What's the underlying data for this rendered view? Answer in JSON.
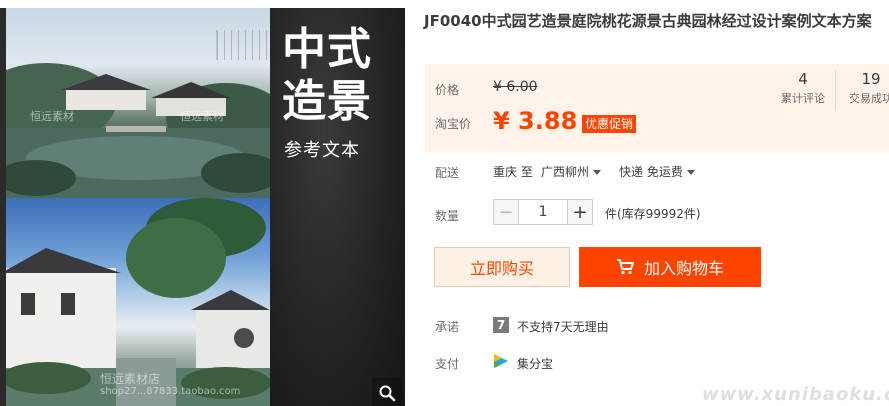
{
  "gallery": {
    "banner_title": "中式造景",
    "banner_subtitle": "参考文本",
    "watermark_top_left": "恒远素材",
    "watermark_top_right": "恒远素材",
    "watermark_bottom": "恒远素材店",
    "watermark_bottom_url": "shop27...87833.taobao.com"
  },
  "product": {
    "title": "JF0040中式园艺造景庭院桃花源景古典园林经过设计案例文本方案"
  },
  "price": {
    "label_price": "价格",
    "original": "¥ 6.00",
    "label_taobao": "淘宝价",
    "current": "¥ 3.88",
    "promo_tag": "优惠促销"
  },
  "stats": [
    {
      "number": "4",
      "label": "累计评论"
    },
    {
      "number": "19",
      "label": "交易成功"
    }
  ],
  "shipping": {
    "label": "配送",
    "from_to": "重庆 至",
    "destination": "广西柳州",
    "method": "快递 免运费"
  },
  "quantity": {
    "label": "数量",
    "minus": "−",
    "value": "1",
    "plus": "+",
    "stock": "件(库存99992件)"
  },
  "actions": {
    "buy_now": "立即购买",
    "add_to_cart": "加入购物车"
  },
  "promise": {
    "label": "承诺",
    "icon_text": "7",
    "text": "不支持7天无理由"
  },
  "payment": {
    "label": "支付",
    "text": "集分宝"
  },
  "site_watermark": "www.xunibaoku.com",
  "colors": {
    "accent": "#ff4400",
    "price_panel_bg": "#fff2e8",
    "buy_button_bg": "#fff0e6"
  }
}
